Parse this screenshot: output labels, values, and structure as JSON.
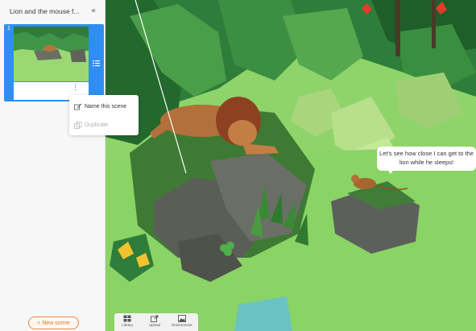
{
  "sidebar": {
    "title": "Lion and the mouse f...",
    "collapse_icon": "«",
    "scene": {
      "number": "1",
      "menu_icon": "⋮"
    },
    "context_menu": [
      {
        "label": "Name this scene",
        "icon": "rename-icon",
        "enabled": true
      },
      {
        "label": "Duplicate",
        "icon": "duplicate-icon",
        "enabled": false
      }
    ],
    "new_scene_label": "+ New scene"
  },
  "viewport": {
    "speech_bubble": "Let's see how close I can get to the lion while he sleeps!"
  },
  "toolbar": {
    "items": [
      {
        "label": "Library",
        "icon": "library-icon"
      },
      {
        "label": "Upload",
        "icon": "upload-icon"
      },
      {
        "label": "Environment",
        "icon": "environment-icon"
      }
    ]
  },
  "colors": {
    "accent": "#2f8ff0",
    "new_scene": "#e07a34",
    "ground": "#8fd46a"
  }
}
